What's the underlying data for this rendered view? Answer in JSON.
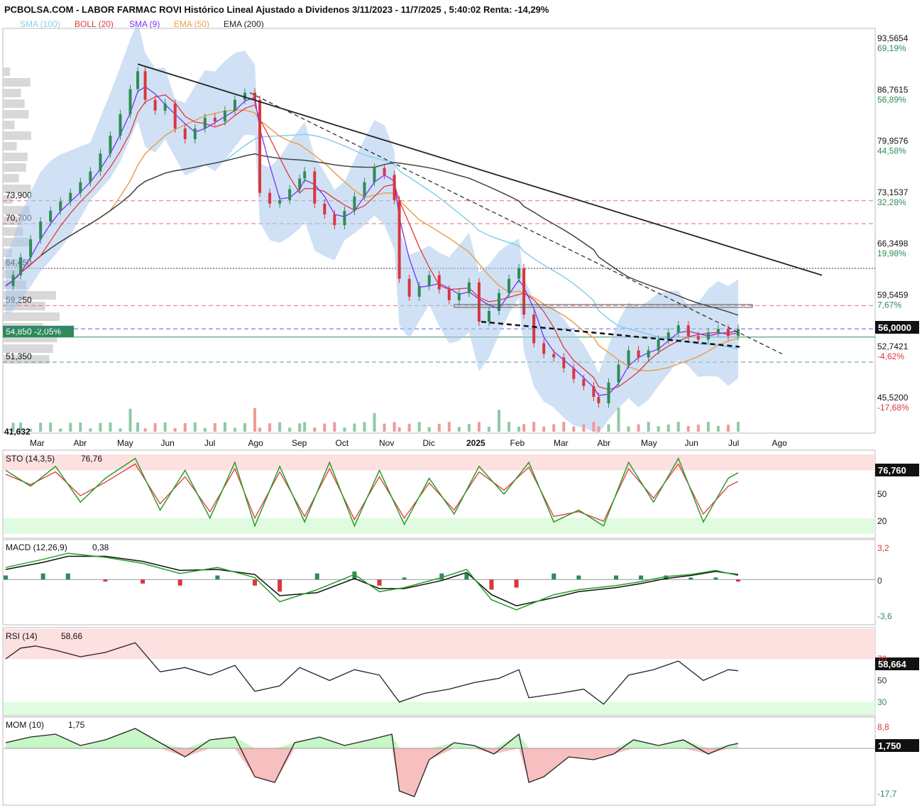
{
  "header": {
    "title": "PCBOLSA.COM - LABOR FARMAC ROVI Histórico Lineal Ajustado a Dividenos 3/11/2023 - 11/7/2025 , 5:40:02 Renta: -14,29%",
    "legend": [
      {
        "label": "SMA (100)",
        "color": "#87ceeb"
      },
      {
        "label": "BOLL (20)",
        "color": "#e03a3a"
      },
      {
        "label": "SMA (9)",
        "color": "#7b2ff7"
      },
      {
        "label": "EMA (50)",
        "color": "#f0a040"
      },
      {
        "label": "EMA (200)",
        "color": "#222222"
      }
    ]
  },
  "colors": {
    "price_up": "#2e8b57",
    "price_down": "#d9363e",
    "sma100": "#87ceeb",
    "boll": "#e03a3a",
    "sma9": "#7b2ff7",
    "ema50": "#e8a050",
    "ema200": "#444444",
    "band_fill": "#aac8ec",
    "overbought_fill": "#fde0e0",
    "oversold_fill": "#e0fbe0",
    "green_line": "#2a9d2a",
    "red_area": "#f08080",
    "green_area": "#90ee90"
  },
  "chart_data": [
    {
      "type": "line",
      "panel": "price",
      "x_labels": [
        "Mar",
        "Abr",
        "May",
        "Jun",
        "Jul",
        "Ago",
        "Sep",
        "Oct",
        "Nov",
        "Dic",
        "2025",
        "Feb",
        "Mar",
        "Abr",
        "May",
        "Jun",
        "Jul",
        "Ago"
      ],
      "ylim": [
        41.632,
        96.0
      ],
      "right_ticks": [
        {
          "value": "93,5654",
          "pct": "69,19%",
          "pct_color": "#2e8b57"
        },
        {
          "value": "86,7615",
          "pct": "56,89%",
          "pct_color": "#2e8b57"
        },
        {
          "value": "79,9576",
          "pct": "44,58%",
          "pct_color": "#2e8b57"
        },
        {
          "value": "73,1537",
          "pct": "32,28%",
          "pct_color": "#2e8b57"
        },
        {
          "value": "66,3498",
          "pct": "19,98%",
          "pct_color": "#2e8b57"
        },
        {
          "value": "59,5459",
          "pct": "7,67%",
          "pct_color": "#2e8b57"
        },
        {
          "value": "52,7421",
          "pct": "-4,62%",
          "pct_color": "#d9363e"
        },
        {
          "value": "45,5200",
          "pct": "-17,68%",
          "pct_color": "#d9363e"
        }
      ],
      "current_price_label": "56,0000",
      "left_levels": [
        {
          "label": "73,900",
          "value": 73.9,
          "style": "dashed",
          "color": "#e07070"
        },
        {
          "label": "70,700",
          "value": 70.7,
          "style": "dashed",
          "color": "#e07070"
        },
        {
          "label": "64,450",
          "value": 64.45,
          "style": "dotted",
          "color": "#333333"
        },
        {
          "label": "59,250",
          "value": 59.25,
          "style": "dashed",
          "color": "#e07070"
        },
        {
          "label": "54,850 -2,05%",
          "value": 54.85,
          "style": "solid",
          "color": "#2e8b57"
        },
        {
          "label": "51,350",
          "value": 51.35,
          "style": "dashed",
          "color": "#4aa080"
        }
      ],
      "bottom_left_label": "41,632",
      "price_series": [
        [
          0,
          62.0
        ],
        [
          3,
          63.5
        ],
        [
          6,
          66.0
        ],
        [
          10,
          68.5
        ],
        [
          14,
          71.0
        ],
        [
          18,
          72.5
        ],
        [
          22,
          73.8
        ],
        [
          26,
          75.0
        ],
        [
          30,
          76.5
        ],
        [
          34,
          78.0
        ],
        [
          38,
          80.5
        ],
        [
          42,
          83.0
        ],
        [
          46,
          86.0
        ],
        [
          50,
          89.5
        ],
        [
          53,
          92.0
        ],
        [
          56,
          88.0
        ],
        [
          60,
          86.5
        ],
        [
          64,
          87.5
        ],
        [
          68,
          84.0
        ],
        [
          72,
          82.5
        ],
        [
          76,
          84.0
        ],
        [
          80,
          85.5
        ],
        [
          84,
          85.0
        ],
        [
          88,
          86.5
        ],
        [
          92,
          88.0
        ],
        [
          96,
          89.0
        ],
        [
          100,
          88.0
        ],
        [
          102,
          75.0
        ],
        [
          106,
          73.5
        ],
        [
          110,
          74.0
        ],
        [
          114,
          75.5
        ],
        [
          118,
          77.0
        ],
        [
          120,
          78.0
        ],
        [
          124,
          73.5
        ],
        [
          128,
          72.0
        ],
        [
          132,
          70.5
        ],
        [
          136,
          72.5
        ],
        [
          140,
          74.5
        ],
        [
          144,
          76.5
        ],
        [
          148,
          78.5
        ],
        [
          152,
          77.5
        ],
        [
          156,
          74.0
        ],
        [
          158,
          63.0
        ],
        [
          162,
          60.5
        ],
        [
          166,
          62.0
        ],
        [
          170,
          63.5
        ],
        [
          174,
          61.5
        ],
        [
          178,
          60.0
        ],
        [
          182,
          61.0
        ],
        [
          186,
          62.5
        ],
        [
          190,
          57.0
        ],
        [
          194,
          58.5
        ],
        [
          198,
          61.0
        ],
        [
          202,
          63.0
        ],
        [
          206,
          64.5
        ],
        [
          208,
          58.0
        ],
        [
          212,
          54.0
        ],
        [
          216,
          52.5
        ],
        [
          220,
          52.0
        ],
        [
          224,
          50.5
        ],
        [
          228,
          49.0
        ],
        [
          232,
          48.0
        ],
        [
          236,
          46.5
        ],
        [
          238,
          45.6
        ],
        [
          242,
          48.5
        ],
        [
          246,
          51.0
        ],
        [
          250,
          53.0
        ],
        [
          254,
          52.0
        ],
        [
          258,
          53.0
        ],
        [
          262,
          54.5
        ],
        [
          266,
          55.5
        ],
        [
          270,
          56.5
        ],
        [
          274,
          55.0
        ],
        [
          278,
          54.5
        ],
        [
          282,
          55.5
        ],
        [
          286,
          56.0
        ],
        [
          290,
          55.0
        ],
        [
          294,
          56.0
        ]
      ]
    },
    {
      "type": "line",
      "panel": "STO",
      "label": "STO (14,3,5)",
      "value": "76,76",
      "value_box": "76,760",
      "ticks": [
        "50",
        "20"
      ],
      "ylim": [
        0,
        100
      ],
      "k": [
        [
          0,
          80
        ],
        [
          10,
          60
        ],
        [
          20,
          85
        ],
        [
          30,
          40
        ],
        [
          40,
          70
        ],
        [
          52,
          95
        ],
        [
          62,
          30
        ],
        [
          72,
          80
        ],
        [
          82,
          20
        ],
        [
          92,
          90
        ],
        [
          100,
          10
        ],
        [
          110,
          85
        ],
        [
          120,
          15
        ],
        [
          130,
          90
        ],
        [
          140,
          10
        ],
        [
          150,
          80
        ],
        [
          160,
          12
        ],
        [
          170,
          70
        ],
        [
          180,
          25
        ],
        [
          190,
          85
        ],
        [
          200,
          50
        ],
        [
          210,
          90
        ],
        [
          220,
          15
        ],
        [
          230,
          30
        ],
        [
          240,
          10
        ],
        [
          250,
          90
        ],
        [
          260,
          40
        ],
        [
          270,
          95
        ],
        [
          280,
          15
        ],
        [
          290,
          70
        ],
        [
          294,
          77
        ]
      ],
      "d": [
        [
          0,
          75
        ],
        [
          10,
          62
        ],
        [
          20,
          78
        ],
        [
          30,
          48
        ],
        [
          40,
          65
        ],
        [
          52,
          88
        ],
        [
          62,
          38
        ],
        [
          72,
          72
        ],
        [
          82,
          28
        ],
        [
          92,
          82
        ],
        [
          100,
          20
        ],
        [
          110,
          78
        ],
        [
          120,
          22
        ],
        [
          130,
          82
        ],
        [
          140,
          18
        ],
        [
          150,
          72
        ],
        [
          160,
          20
        ],
        [
          170,
          64
        ],
        [
          180,
          30
        ],
        [
          190,
          78
        ],
        [
          200,
          55
        ],
        [
          210,
          84
        ],
        [
          220,
          22
        ],
        [
          230,
          28
        ],
        [
          240,
          16
        ],
        [
          250,
          82
        ],
        [
          260,
          45
        ],
        [
          270,
          88
        ],
        [
          280,
          25
        ],
        [
          290,
          60
        ],
        [
          294,
          66
        ]
      ]
    },
    {
      "type": "line",
      "panel": "MACD",
      "label": "MACD (12,26,9)",
      "value": "0,38",
      "ticks": [
        "3,2",
        "0",
        "-3,6"
      ],
      "tick_colors": [
        "#d9363e",
        "#333333",
        "#2e8b57"
      ],
      "ylim": [
        -4.2,
        3.6
      ],
      "macd": [
        [
          0,
          1.2
        ],
        [
          15,
          2.0
        ],
        [
          25,
          2.6
        ],
        [
          40,
          2.2
        ],
        [
          55,
          1.6
        ],
        [
          70,
          0.6
        ],
        [
          85,
          1.2
        ],
        [
          100,
          0.2
        ],
        [
          110,
          -2.2
        ],
        [
          125,
          -1.0
        ],
        [
          140,
          0.5
        ],
        [
          150,
          -1.2
        ],
        [
          160,
          -0.8
        ],
        [
          175,
          0.2
        ],
        [
          185,
          1.0
        ],
        [
          195,
          -2.0
        ],
        [
          205,
          -3.0
        ],
        [
          220,
          -1.5
        ],
        [
          230,
          -1.0
        ],
        [
          245,
          -0.6
        ],
        [
          255,
          -0.2
        ],
        [
          265,
          0.3
        ],
        [
          275,
          0.5
        ],
        [
          285,
          0.9
        ],
        [
          294,
          0.4
        ]
      ],
      "signal": [
        [
          0,
          1.0
        ],
        [
          15,
          1.7
        ],
        [
          25,
          2.3
        ],
        [
          40,
          2.3
        ],
        [
          55,
          1.8
        ],
        [
          70,
          0.9
        ],
        [
          85,
          1.0
        ],
        [
          100,
          0.5
        ],
        [
          110,
          -1.6
        ],
        [
          125,
          -1.3
        ],
        [
          140,
          0.1
        ],
        [
          150,
          -0.9
        ],
        [
          160,
          -0.9
        ],
        [
          175,
          -0.1
        ],
        [
          185,
          0.7
        ],
        [
          195,
          -1.5
        ],
        [
          205,
          -2.6
        ],
        [
          220,
          -1.8
        ],
        [
          230,
          -1.2
        ],
        [
          245,
          -0.8
        ],
        [
          255,
          -0.4
        ],
        [
          265,
          0.1
        ],
        [
          275,
          0.4
        ],
        [
          285,
          0.8
        ],
        [
          294,
          0.5
        ]
      ]
    },
    {
      "type": "line",
      "panel": "RSI",
      "label": "RSI (14)",
      "value": "58,66",
      "value_box": "58,664",
      "ticks": [
        "70",
        "50",
        "30"
      ],
      "tick_colors": [
        "#d9363e",
        "#333333",
        "#2e8b57"
      ],
      "ylim": [
        20,
        95
      ],
      "rsi": [
        [
          0,
          70
        ],
        [
          6,
          80
        ],
        [
          12,
          82
        ],
        [
          20,
          78
        ],
        [
          30,
          72
        ],
        [
          40,
          76
        ],
        [
          52,
          85
        ],
        [
          62,
          58
        ],
        [
          72,
          62
        ],
        [
          82,
          55
        ],
        [
          92,
          64
        ],
        [
          100,
          40
        ],
        [
          110,
          45
        ],
        [
          118,
          62
        ],
        [
          130,
          50
        ],
        [
          140,
          60
        ],
        [
          150,
          55
        ],
        [
          158,
          30
        ],
        [
          168,
          38
        ],
        [
          178,
          42
        ],
        [
          188,
          48
        ],
        [
          198,
          52
        ],
        [
          206,
          60
        ],
        [
          210,
          34
        ],
        [
          222,
          38
        ],
        [
          232,
          42
        ],
        [
          240,
          28
        ],
        [
          250,
          55
        ],
        [
          260,
          60
        ],
        [
          270,
          68
        ],
        [
          280,
          50
        ],
        [
          290,
          60
        ],
        [
          294,
          59
        ]
      ]
    },
    {
      "type": "area",
      "panel": "MOM",
      "label": "MOM (10)",
      "value": "1,75",
      "value_box": "1,750",
      "ticks": [
        "8,8",
        "-17,7"
      ],
      "tick_colors": [
        "#d9363e",
        "#2e8b57"
      ],
      "ylim": [
        -19,
        10
      ],
      "mom": [
        [
          0,
          2
        ],
        [
          10,
          4
        ],
        [
          20,
          5
        ],
        [
          30,
          1
        ],
        [
          40,
          3
        ],
        [
          52,
          7
        ],
        [
          62,
          2
        ],
        [
          72,
          -3
        ],
        [
          82,
          3
        ],
        [
          92,
          4
        ],
        [
          100,
          -10
        ],
        [
          108,
          -12
        ],
        [
          116,
          2
        ],
        [
          126,
          4
        ],
        [
          136,
          1
        ],
        [
          146,
          3
        ],
        [
          155,
          5
        ],
        [
          158,
          -15
        ],
        [
          164,
          -17
        ],
        [
          170,
          -4
        ],
        [
          180,
          2
        ],
        [
          188,
          1
        ],
        [
          196,
          -2
        ],
        [
          206,
          5
        ],
        [
          210,
          -12
        ],
        [
          216,
          -10
        ],
        [
          226,
          -3
        ],
        [
          236,
          -4
        ],
        [
          244,
          -2
        ],
        [
          252,
          3
        ],
        [
          262,
          1
        ],
        [
          272,
          3
        ],
        [
          282,
          -2
        ],
        [
          290,
          1
        ],
        [
          294,
          1.75
        ]
      ]
    }
  ]
}
